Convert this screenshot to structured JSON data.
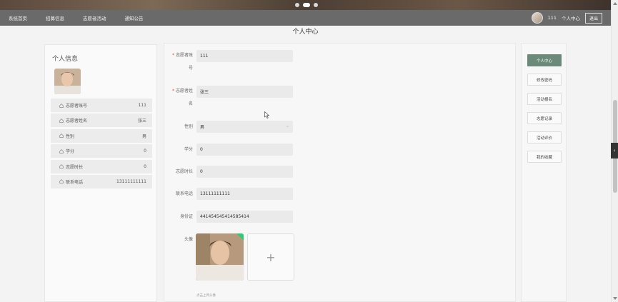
{
  "nav": {
    "items": [
      "系统首页",
      "招募信息",
      "志愿者活动",
      "通知公告"
    ],
    "user": "111",
    "center": "个人中心",
    "logout": "退出"
  },
  "page_title": "个人中心",
  "profile": {
    "title": "个人信息",
    "rows": [
      {
        "label": "志愿者账号",
        "value": "111"
      },
      {
        "label": "志愿者姓名",
        "value": "张三"
      },
      {
        "label": "性别",
        "value": "男"
      },
      {
        "label": "学分",
        "value": "0"
      },
      {
        "label": "志愿时长",
        "value": "0"
      },
      {
        "label": "联系电话",
        "value": "13111111111"
      }
    ]
  },
  "form": {
    "account_label_1": "志愿者账",
    "account_label_2": "号",
    "account_value": "111",
    "name_label_1": "志愿者姓",
    "name_label_2": "名",
    "name_value": "张三",
    "gender_label": "性别",
    "gender_value": "男",
    "credit_label": "学分",
    "credit_value": "0",
    "hours_label": "志愿时长",
    "hours_value": "0",
    "phone_label": "联系电话",
    "phone_value": "13111111111",
    "idcard_label": "身份证",
    "idcard_value": "441454545414585414",
    "avatar_label": "头像",
    "upload_plus": "+",
    "upload_hint": "点击上传头像",
    "required_mark": "*"
  },
  "menu": [
    "个人中心",
    "修改密码",
    "活动报名",
    "志愿记录",
    "活动评价",
    "我的收藏"
  ],
  "side_tab": "‹",
  "colors": {
    "accent": "#6c8a7a",
    "nav": "#6a6a6a"
  }
}
